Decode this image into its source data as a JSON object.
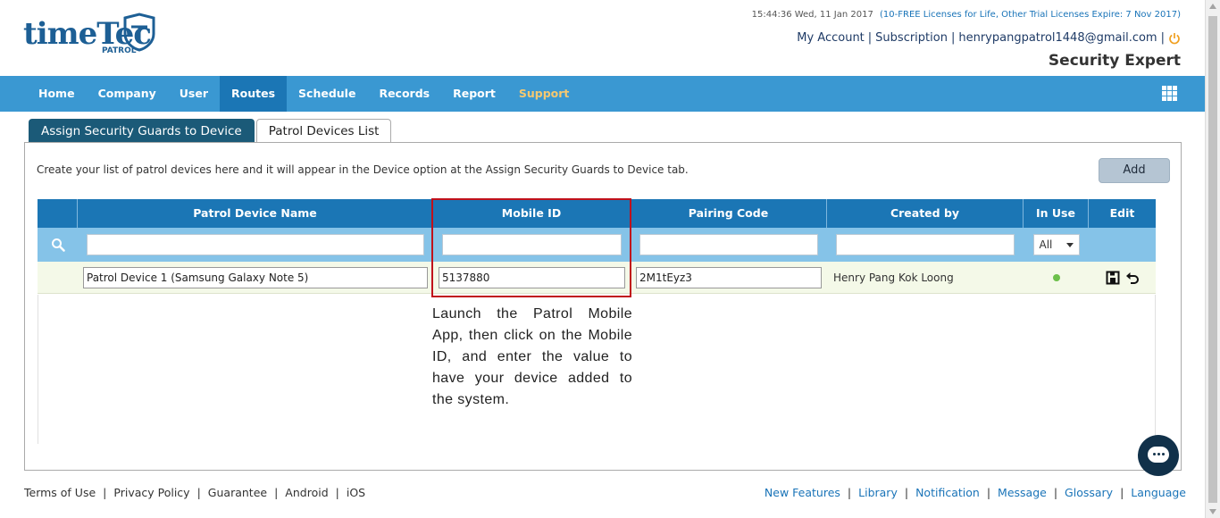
{
  "logo": {
    "word": "timeTec",
    "sub": "PATROL"
  },
  "header": {
    "datetime": "15:44:36 Wed, 11 Jan 2017",
    "license_note": "(10-FREE Licenses for Life, Other Trial Licenses Expire:  7 Nov 2017)",
    "account_links": [
      "My Account",
      "Subscription",
      "henrypangpatrol1448@gmail.com"
    ],
    "role": "Security Expert"
  },
  "nav": {
    "items": [
      "Home",
      "Company",
      "User",
      "Routes",
      "Schedule",
      "Records",
      "Report",
      "Support"
    ],
    "active": "Routes"
  },
  "tabs": [
    "Assign Security Guards to Device",
    "Patrol Devices List"
  ],
  "panel": {
    "description": "Create your list of patrol devices here and it will appear in the Device option at the Assign Security Guards to Device tab.",
    "add_label": "Add"
  },
  "table": {
    "headers": [
      "Patrol Device Name",
      "Mobile ID",
      "Pairing Code",
      "Created by",
      "In Use",
      "Edit"
    ],
    "filter_select": "All",
    "rows": [
      {
        "device_name": "Patrol Device 1 (Samsung Galaxy Note 5)",
        "mobile_id": "5137880",
        "pairing_code": "2M1tEyz3",
        "created_by": "Henry Pang Kok Loong",
        "in_use": true
      }
    ]
  },
  "annotation": "Launch the Patrol Mobile App, then click on the Mobile ID, and enter the value to have your device added to the system.",
  "footer": {
    "left": [
      "Terms of Use",
      "Privacy Policy",
      "Guarantee",
      "Android",
      "iOS"
    ],
    "right": [
      "New Features",
      "Library",
      "Notification",
      "Message",
      "Glossary",
      "Language"
    ]
  },
  "colors": {
    "nav": "#3a98d2",
    "nav_active": "#1b76b5",
    "support": "#f5c870",
    "header_row": "#1b76b5",
    "filter_row": "#85c3e8",
    "highlight": "#c0111b",
    "in_use_dot": "#6cc04a"
  },
  "icons": {
    "search": "search-icon",
    "apps": "apps-grid-icon",
    "power": "power-icon",
    "save": "save-icon",
    "undo": "undo-icon",
    "chat": "chat-icon"
  }
}
